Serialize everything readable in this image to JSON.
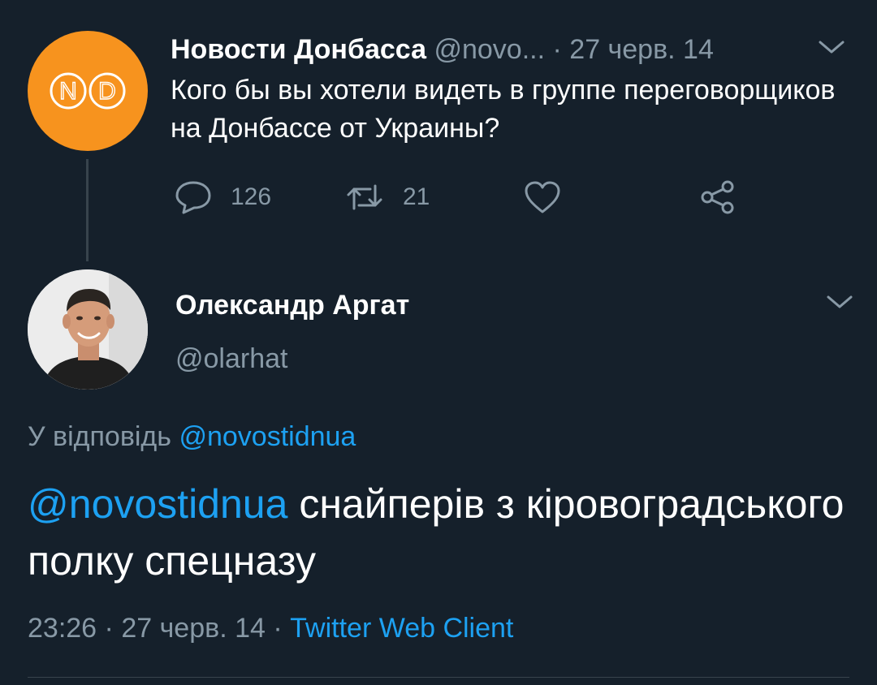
{
  "parent_tweet": {
    "author_name": "Новости Донбасса",
    "author_handle": "@novo...",
    "separator": "·",
    "date": "27 черв. 14",
    "text": "Кого бы вы хотели видеть в группе переговорщиков на Донбассе от Украины?",
    "avatar_logo": {
      "letters": [
        "N",
        "D"
      ],
      "background": "#f7931e"
    },
    "actions": {
      "reply_count": "126",
      "retweet_count": "21"
    }
  },
  "reply_tweet": {
    "author_name": "Олександр Аргат",
    "author_handle": "@olarhat",
    "reply_to_label": "У відповідь",
    "reply_to_handle": "@novostidnua",
    "text_mention": "@novostidnua",
    "text_body": " снайперів з кіровоградського полку спецназу",
    "time": "23:26",
    "separator": "·",
    "date": "27 черв. 14",
    "client": "Twitter Web Client"
  },
  "icons": {
    "reply": "comment-bubble-icon",
    "retweet": "retweet-icon",
    "like": "heart-icon",
    "share": "share-icon",
    "menu": "chevron-down-icon"
  },
  "colors": {
    "background": "#15202b",
    "text": "#ffffff",
    "muted": "#8899a6",
    "link": "#1da1f2",
    "divider": "#38444d"
  }
}
